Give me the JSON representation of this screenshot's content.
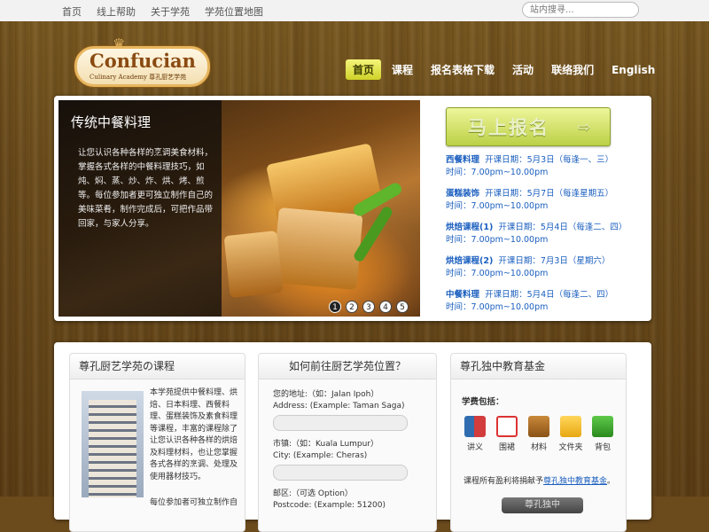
{
  "topnav": [
    "首页",
    "线上帮助",
    "关于学苑",
    "学苑位置地图"
  ],
  "search": {
    "placeholder": "站内搜寻..."
  },
  "logo": {
    "name": "Confucian",
    "sub": "Culinary Academy 尊孔厨艺学苑"
  },
  "mainnav": [
    "首页",
    "课程",
    "报名表格下载",
    "活动",
    "联络我们",
    "English"
  ],
  "slide": {
    "title": "传统中餐料理",
    "desc": "让您认识各种各样的烹调美食材料，掌握各式各样的中餐料理技巧，如炖、焖、蒸、炒、炸、烘、烤、煎等。每位参加者更可独立制作自己的美味菜肴，制作完成后，可把作品带回家，与家人分享。",
    "dots": [
      "1",
      "2",
      "3",
      "4",
      "5"
    ]
  },
  "signup": {
    "label": "马上报名",
    "arrow": "⇨"
  },
  "courses": [
    {
      "name": "西餐料理",
      "date": "开课日期：5月3日（每逢一、三）",
      "time": "时间：7.00pm~10.00pm"
    },
    {
      "name": "蛋糕装饰",
      "date": "开课日期：5月7日（每逢星期五）",
      "time": "时间：7.00pm~10.00pm"
    },
    {
      "name": "烘焙课程(1)",
      "date": "开课日期：5月4日（每逢二、四）",
      "time": "时间：7.00pm~10.00pm"
    },
    {
      "name": "烘焙课程(2)",
      "date": "开课日期：7月3日（星期六）",
      "time": "时间：7.00pm~10.00pm"
    },
    {
      "name": "中餐料理",
      "date": "开课日期：5月4日（每逢二、四）",
      "time": "时间：7.00pm~10.00pm"
    }
  ],
  "col1": {
    "title": "尊孔厨艺学苑の课程",
    "text": "本学苑提供中餐料理、烘焙、日本料理、西餐料理、蛋糕装饰及素食料理等课程，丰富的课程除了让您认识各种各样的烘焙及料理材料，也让您掌握各式各样的烹调、处理及使用器材技巧。",
    "more": "每位参加者可独立制作自"
  },
  "col2": {
    "title": "如何前往厨艺学苑位置？",
    "address_cn": "您的地址:（如：Jalan Ipoh）",
    "address_en": "Address: (Example: Taman Saga)",
    "city_cn": "市镇:（如：Kuala Lumpur）",
    "city_en": "City: (Example: Cheras)",
    "post_cn": "邮区:（可选 Option）",
    "post_en": "Postcode: (Example: 51200)"
  },
  "col3": {
    "title": "尊孔独中教育基金",
    "label": "学费包括：",
    "icons": [
      "讲义",
      "围裙",
      "材料",
      "文件夹",
      "背包"
    ],
    "note_prefix": "课程所有盈利将捐献予",
    "note_link": "尊孔独中教育基金",
    "note_suffix": "。",
    "button": "尊孔独中"
  },
  "colors": {
    "accent": "#1b5fbf",
    "nav_active": "#e3e54f",
    "signup": "#c9dc58"
  }
}
